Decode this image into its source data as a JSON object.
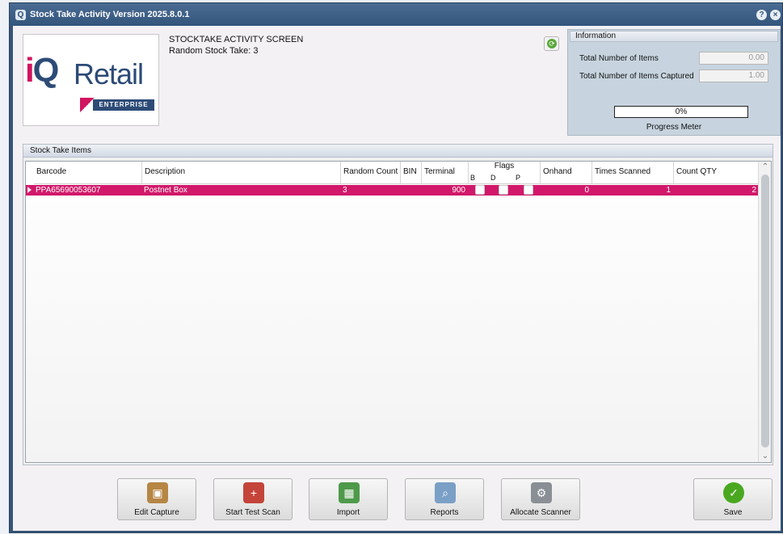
{
  "window": {
    "title": "Stock Take Activity Version 2025.8.0.1",
    "help_glyph": "?",
    "close_glyph": "×",
    "app_glyph": "Q"
  },
  "header": {
    "screen_name": "STOCKTAKE ACTIVITY SCREEN",
    "subtitle": "Random Stock Take: 3"
  },
  "logo": {
    "iq_i": "i",
    "iq_q": "Q",
    "word": "Retail",
    "edition": "ENTERPRISE"
  },
  "info": {
    "heading": "Information",
    "total_items_label": "Total Number of Items",
    "total_items_value": "0.00",
    "captured_label": "Total Number of Items Captured",
    "captured_value": "1.00",
    "progress_text": "0%",
    "progress_fraction": 0,
    "progress_caption": "Progress Meter"
  },
  "grid": {
    "heading": "Stock Take Items",
    "columns": {
      "barcode": "Barcode",
      "description": "Description",
      "random_count": "Random Count",
      "bin": "BIN",
      "terminal": "Terminal",
      "flags": "Flags",
      "flag_b": "B",
      "flag_d": "D",
      "flag_p": "P",
      "onhand": "Onhand",
      "times_scanned": "Times Scanned",
      "count_qty": "Count QTY"
    },
    "rows": [
      {
        "barcode": "PPA65690053607",
        "description": "Postnet Box",
        "random_count": "3",
        "bin": "",
        "terminal": "900",
        "flag_b": false,
        "flag_d": false,
        "flag_p": false,
        "onhand": "0",
        "times_scanned": "1",
        "count_qty": "2"
      }
    ]
  },
  "toolbar": {
    "edit_capture": "Edit Capture",
    "start_test_scan": "Start Test Scan",
    "import": "Import",
    "reports": "Reports",
    "allocate_scanner": "Allocate Scanner",
    "save": "Save"
  },
  "colors": {
    "selected_row": "#d1186a",
    "brand_navy": "#2d4b77",
    "brand_pink": "#d1155f"
  }
}
